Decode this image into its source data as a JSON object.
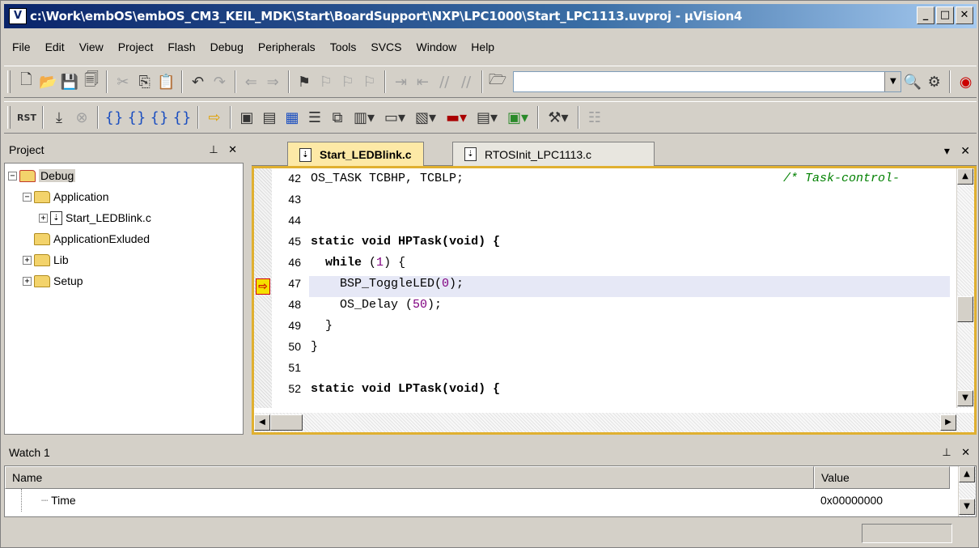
{
  "window": {
    "title": "c:\\Work\\embOS\\embOS_CM3_KEIL_MDK\\Start\\BoardSupport\\NXP\\LPC1000\\Start_LPC1113.uvproj - µVision4",
    "app_icon_letter": "V",
    "minimize": "_",
    "maximize": "□",
    "close": "✕"
  },
  "menu": [
    "File",
    "Edit",
    "View",
    "Project",
    "Flash",
    "Debug",
    "Peripherals",
    "Tools",
    "SVCS",
    "Window",
    "Help"
  ],
  "toolbar1": {
    "combo_value": "",
    "icons": [
      "new-file-icon",
      "open-folder-icon",
      "save-icon",
      "save-all-icon",
      "cut-icon",
      "copy-icon",
      "paste-icon",
      "undo-icon",
      "redo-icon",
      "navigate-back-icon",
      "navigate-forward-icon",
      "bookmark-icon",
      "bookmark-prev-icon",
      "bookmark-next-icon",
      "bookmark-clear-icon",
      "indent-icon",
      "unindent-icon",
      "comment-icon",
      "uncomment-icon",
      "find-in-files-icon",
      "find-icon",
      "debug-session-icon",
      "insight-icon"
    ]
  },
  "toolbar2": {
    "icons": [
      "reset-icon",
      "run-icon",
      "stop-icon",
      "step-into-icon",
      "step-over-icon",
      "step-out-icon",
      "run-to-cursor-icon",
      "show-next-statement-icon",
      "command-window-icon",
      "disassembly-window-icon",
      "symbols-window-icon",
      "registers-window-icon",
      "call-stack-icon",
      "watch-window-icon",
      "memory-window-icon",
      "serial-window-icon",
      "analysis-window-icon",
      "trace-window-icon",
      "system-viewer-icon",
      "toolbox-icon",
      "settings-icon"
    ]
  },
  "project": {
    "title": "Project",
    "pin": "⊥",
    "close": "✕",
    "tree": [
      {
        "label": "Debug",
        "level": 0,
        "exp": "−"
      },
      {
        "label": "Application",
        "level": 1,
        "exp": "−"
      },
      {
        "label": "Start_LEDBlink.c",
        "level": 2,
        "exp": "+"
      },
      {
        "label": "ApplicationExluded",
        "level": 1,
        "exp": ""
      },
      {
        "label": "Lib",
        "level": 1,
        "exp": "+"
      },
      {
        "label": "Setup",
        "level": 1,
        "exp": "+"
      }
    ]
  },
  "editor": {
    "tabs": [
      "Start_LEDBlink.c",
      "RTOSInit_LPC1113.c"
    ],
    "tab_menu": "▾",
    "tab_close": "✕",
    "lines": [
      {
        "n": "42",
        "text": "OS_TASK TCBHP, TCBLP;"
      },
      {
        "n": "43",
        "text": ""
      },
      {
        "n": "44",
        "text": ""
      },
      {
        "n": "45",
        "text": "static void HPTask(void) {"
      },
      {
        "n": "46",
        "text": "  while (1) {"
      },
      {
        "n": "47",
        "text": "    BSP_ToggleLED(0);"
      },
      {
        "n": "48",
        "text": "    OS_Delay (50);"
      },
      {
        "n": "49",
        "text": "  }"
      },
      {
        "n": "50",
        "text": "}"
      },
      {
        "n": "51",
        "text": ""
      },
      {
        "n": "52",
        "text": "static void LPTask(void) {"
      }
    ],
    "comment_42": "/* Task-control-",
    "current_line": "47",
    "breakpoint_arrow": "⇨"
  },
  "watch": {
    "title": "Watch 1",
    "pin": "⊥",
    "close": "✕",
    "columns": [
      "Name",
      "Value"
    ],
    "rows": [
      {
        "name": "Time",
        "value": "0x00000000"
      }
    ]
  }
}
